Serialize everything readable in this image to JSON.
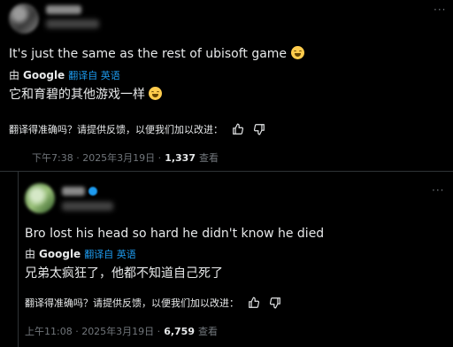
{
  "post1": {
    "text": "It's just the same as the rest of ubisoft game",
    "by_label": "由",
    "google_label": "Google",
    "translate_link": "翻译自 英语",
    "translated": "它和育碧的其他游戏一样",
    "feedback": "翻译得准确吗？请提供反馈，以便我们加以改进：",
    "time": "下午7:38 · 2025年3月19日 ·",
    "views": "1,337",
    "views_label": "查看"
  },
  "post2": {
    "text": "Bro lost his head so hard he didn't know he died",
    "by_label": "由",
    "google_label": "Google",
    "translate_link": "翻译自 英语",
    "translated": "兄弟太疯狂了，他都不知道自己死了",
    "feedback": "翻译得准确吗？请提供反馈，以便我们加以改进：",
    "time": "上午11:08 · 2025年3月19日 ·",
    "views": "6,759",
    "views_label": "查看"
  },
  "icons": [
    "more-icon",
    "thumbs-up-icon",
    "thumbs-down-icon",
    "emoji-grinning-icon",
    "verified-badge-icon"
  ],
  "colors": {
    "background": "#000000",
    "text": "#e7e9ea",
    "link": "#1d9bf0",
    "muted": "#71767b",
    "divider": "#2f3336"
  }
}
